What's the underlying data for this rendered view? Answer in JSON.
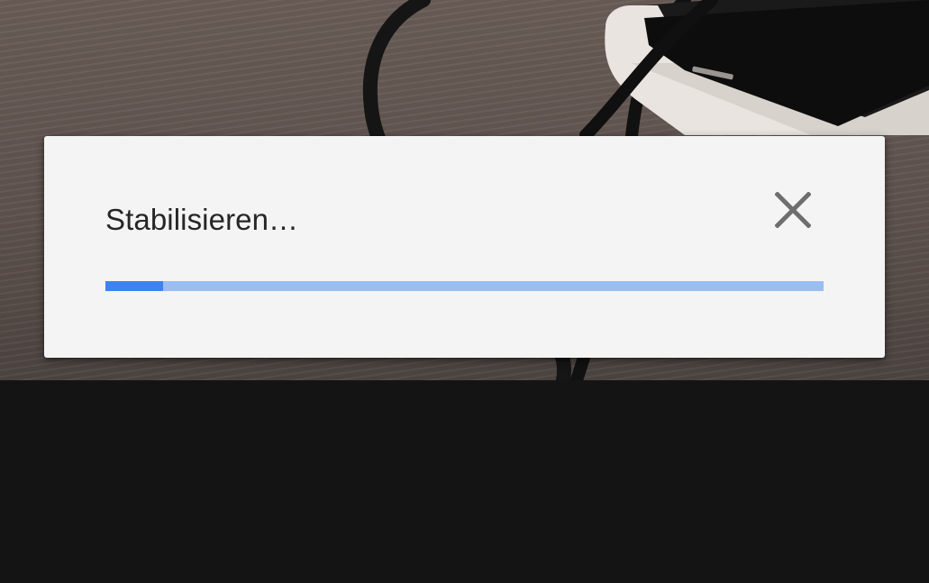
{
  "dialog": {
    "title": "Stabilisieren…",
    "close_icon": "close-icon",
    "progress": 0.08
  },
  "colors": {
    "dialog_background": "#f4f4f4",
    "progress_track": "#9abef2",
    "progress_fill": "#3e82ee",
    "screen_background": "#141414"
  }
}
